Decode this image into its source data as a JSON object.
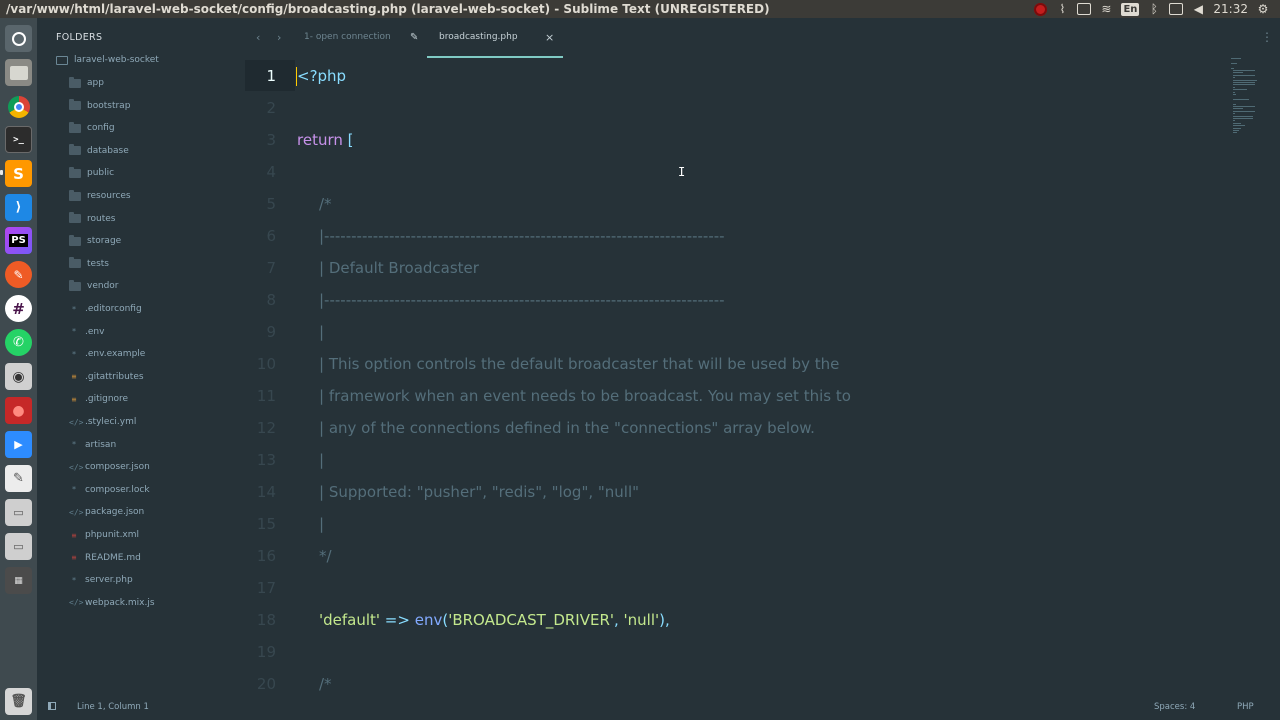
{
  "window_title": "/var/www/html/laravel-web-socket/config/broadcasting.php (laravel-web-socket) - Sublime Text (UNREGISTERED)",
  "tray": {
    "keyboard": "En",
    "clock": "21:32"
  },
  "launcher": [
    "ubuntu-dash-icon",
    "files-icon",
    "chrome-icon",
    "terminal-icon",
    "sublime-text-icon",
    "vscode-icon",
    "phpstorm-icon",
    "postman-icon",
    "slack-icon",
    "whatsapp-icon",
    "screenshot-icon",
    "record-icon",
    "zoom-icon",
    "text-editor-icon",
    "drive-icon",
    "drive-icon-2",
    "workspace-icon",
    "trash-icon"
  ],
  "sidebar": {
    "header": "FOLDERS",
    "root": "laravel-web-socket",
    "folders": [
      "app",
      "bootstrap",
      "config",
      "database",
      "public",
      "resources",
      "routes",
      "storage",
      "tests",
      "vendor"
    ],
    "files": [
      {
        "name": ".editorconfig",
        "icon": "*"
      },
      {
        "name": ".env",
        "icon": "*"
      },
      {
        "name": ".env.example",
        "icon": "*"
      },
      {
        "name": ".gitattributes",
        "icon": "≡"
      },
      {
        "name": ".gitignore",
        "icon": "≡"
      },
      {
        "name": ".styleci.yml",
        "icon": "</>"
      },
      {
        "name": "artisan",
        "icon": "*"
      },
      {
        "name": "composer.json",
        "icon": "</>"
      },
      {
        "name": "composer.lock",
        "icon": "*"
      },
      {
        "name": "package.json",
        "icon": "</>"
      },
      {
        "name": "phpunit.xml",
        "icon": "≡"
      },
      {
        "name": "README.md",
        "icon": "≡"
      },
      {
        "name": "server.php",
        "icon": "*"
      },
      {
        "name": "webpack.mix.js",
        "icon": "</>"
      }
    ]
  },
  "tabs": {
    "inactive": "1- open connection",
    "active": "broadcasting.php",
    "close": "×"
  },
  "editor": {
    "lines": [
      {
        "n": "1",
        "parts": [
          [
            "c-tag",
            "<?php"
          ]
        ]
      },
      {
        "n": "2",
        "parts": []
      },
      {
        "n": "3",
        "parts": [
          [
            "c-kw",
            "return "
          ],
          [
            "c-punc",
            "["
          ]
        ]
      },
      {
        "n": "4",
        "parts": []
      },
      {
        "n": "5",
        "indent": true,
        "parts": [
          [
            "c-comment",
            "/*"
          ]
        ]
      },
      {
        "n": "6",
        "indent": true,
        "parts": [
          [
            "c-comment",
            "|--------------------------------------------------------------------------"
          ]
        ]
      },
      {
        "n": "7",
        "indent": true,
        "parts": [
          [
            "c-comment",
            "| Default Broadcaster"
          ]
        ]
      },
      {
        "n": "8",
        "indent": true,
        "parts": [
          [
            "c-comment",
            "|--------------------------------------------------------------------------"
          ]
        ]
      },
      {
        "n": "9",
        "indent": true,
        "parts": [
          [
            "c-comment",
            "|"
          ]
        ]
      },
      {
        "n": "10",
        "indent": true,
        "parts": [
          [
            "c-comment",
            "| This option controls the default broadcaster that will be used by the"
          ]
        ]
      },
      {
        "n": "11",
        "indent": true,
        "parts": [
          [
            "c-comment",
            "| framework when an event needs to be broadcast. You may set this to"
          ]
        ]
      },
      {
        "n": "12",
        "indent": true,
        "parts": [
          [
            "c-comment",
            "| any of the connections defined in the \"connections\" array below."
          ]
        ]
      },
      {
        "n": "13",
        "indent": true,
        "parts": [
          [
            "c-comment",
            "|"
          ]
        ]
      },
      {
        "n": "14",
        "indent": true,
        "parts": [
          [
            "c-comment",
            "| Supported: \"pusher\", \"redis\", \"log\", \"null\""
          ]
        ]
      },
      {
        "n": "15",
        "indent": true,
        "parts": [
          [
            "c-comment",
            "|"
          ]
        ]
      },
      {
        "n": "16",
        "indent": true,
        "parts": [
          [
            "c-comment",
            "*/"
          ]
        ]
      },
      {
        "n": "17",
        "parts": []
      },
      {
        "n": "18",
        "indent": true,
        "parts": [
          [
            "c-str",
            "'default'"
          ],
          [
            "c-op",
            " => "
          ],
          [
            "c-fn",
            "env"
          ],
          [
            "c-punc",
            "("
          ],
          [
            "c-str",
            "'BROADCAST_DRIVER'"
          ],
          [
            "c-punc",
            ", "
          ],
          [
            "c-str",
            "'null'"
          ],
          [
            "c-punc",
            "),"
          ]
        ]
      },
      {
        "n": "19",
        "parts": []
      },
      {
        "n": "20",
        "indent": true,
        "parts": [
          [
            "c-comment",
            "/*"
          ]
        ]
      }
    ]
  },
  "status": {
    "position": "Line 1, Column 1",
    "spaces": "Spaces: 4",
    "syntax": "PHP"
  }
}
